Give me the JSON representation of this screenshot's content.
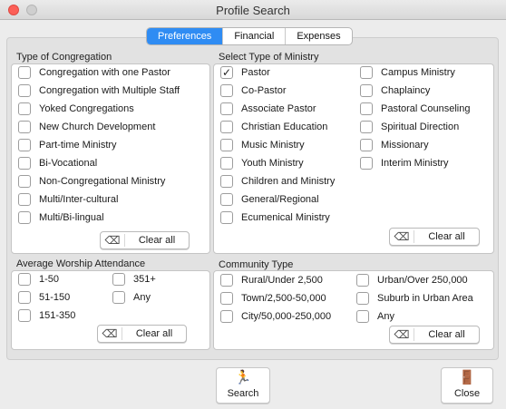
{
  "window": {
    "title": "Profile Search"
  },
  "tabs": [
    {
      "label": "Preferences",
      "active": true
    },
    {
      "label": "Financial",
      "active": false
    },
    {
      "label": "Expenses",
      "active": false
    }
  ],
  "congregation": {
    "title": "Type of Congregation",
    "items": [
      {
        "label": "Congregation with one Pastor",
        "checked": false
      },
      {
        "label": "Congregation with Multiple Staff",
        "checked": false
      },
      {
        "label": "Yoked Congregations",
        "checked": false
      },
      {
        "label": "New Church Development",
        "checked": false
      },
      {
        "label": "Part-time Ministry",
        "checked": false
      },
      {
        "label": "Bi-Vocational",
        "checked": false
      },
      {
        "label": "Non-Congregational Ministry",
        "checked": false
      },
      {
        "label": "Multi/Inter-cultural",
        "checked": false
      },
      {
        "label": "Multi/Bi-lingual",
        "checked": false
      }
    ],
    "clear_label": "Clear all"
  },
  "ministry": {
    "title": "Select Type of Ministry",
    "col1": [
      {
        "label": "Pastor",
        "checked": true
      },
      {
        "label": "Co-Pastor",
        "checked": false
      },
      {
        "label": "Associate Pastor",
        "checked": false
      },
      {
        "label": "Christian Education",
        "checked": false
      },
      {
        "label": "Music Ministry",
        "checked": false
      },
      {
        "label": "Youth Ministry",
        "checked": false
      },
      {
        "label": "Children and Ministry",
        "checked": false
      },
      {
        "label": "General/Regional",
        "checked": false
      },
      {
        "label": "Ecumenical Ministry",
        "checked": false
      }
    ],
    "col2": [
      {
        "label": "Campus Ministry",
        "checked": false
      },
      {
        "label": "Chaplaincy",
        "checked": false
      },
      {
        "label": "Pastoral Counseling",
        "checked": false
      },
      {
        "label": "Spiritual Direction",
        "checked": false
      },
      {
        "label": "Missionary",
        "checked": false
      },
      {
        "label": "Interim Ministry",
        "checked": false
      }
    ],
    "clear_label": "Clear all"
  },
  "attendance": {
    "title": "Average Worship Attendance",
    "col1": [
      {
        "label": "1-50",
        "checked": false
      },
      {
        "label": "51-150",
        "checked": false
      },
      {
        "label": "151-350",
        "checked": false
      }
    ],
    "col2": [
      {
        "label": "351+",
        "checked": false
      },
      {
        "label": "Any",
        "checked": false
      }
    ],
    "clear_label": "Clear all"
  },
  "community": {
    "title": "Community Type",
    "col1": [
      {
        "label": "Rural/Under 2,500",
        "checked": false
      },
      {
        "label": "Town/2,500-50,000",
        "checked": false
      },
      {
        "label": "City/50,000-250,000",
        "checked": false
      }
    ],
    "col2": [
      {
        "label": "Urban/Over 250,000",
        "checked": false
      },
      {
        "label": "Suburb in Urban Area",
        "checked": false
      },
      {
        "label": "Any",
        "checked": false
      }
    ],
    "clear_label": "Clear all"
  },
  "buttons": {
    "search_label": "Search",
    "close_label": "Close"
  },
  "icons": {
    "checked_glyph": "✓",
    "eraser_glyph": "⌫",
    "search_glyph": "🏃",
    "close_glyph": "🚪"
  },
  "colors": {
    "accent": "#2f8cf3",
    "close_light": "#fc5f57"
  }
}
